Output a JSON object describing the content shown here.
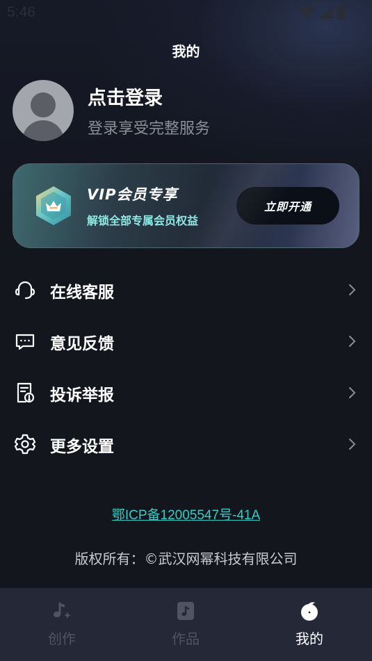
{
  "status_bar": {
    "time": "5:46"
  },
  "header": {
    "title": "我的"
  },
  "profile": {
    "login_title": "点击登录",
    "login_subtitle": "登录享受完整服务"
  },
  "vip": {
    "title": "VIP会员专享",
    "subtitle": "解锁全部专属会员权益",
    "button_label": "立即开通"
  },
  "menu": {
    "items": [
      {
        "label": "在线客服",
        "icon": "headset-icon"
      },
      {
        "label": "意见反馈",
        "icon": "feedback-icon"
      },
      {
        "label": "投诉举报",
        "icon": "report-icon"
      },
      {
        "label": "更多设置",
        "icon": "gear-icon"
      }
    ]
  },
  "footer": {
    "icp": "鄂ICP备12005547号-41A",
    "copyright": "版权所有：©武汉网幂科技有限公司"
  },
  "tabbar": {
    "tabs": [
      {
        "label": "创作",
        "icon": "music-note-sparkle-icon",
        "active": false
      },
      {
        "label": "作品",
        "icon": "music-file-icon",
        "active": false
      },
      {
        "label": "我的",
        "icon": "user-circle-icon",
        "active": true
      }
    ]
  },
  "colors": {
    "background": "#14161e",
    "accent": "#2fcfc7",
    "vip_subtitle": "#8fe8e4",
    "tabbar": "#252837",
    "inactive_tab": "#4f5462"
  }
}
